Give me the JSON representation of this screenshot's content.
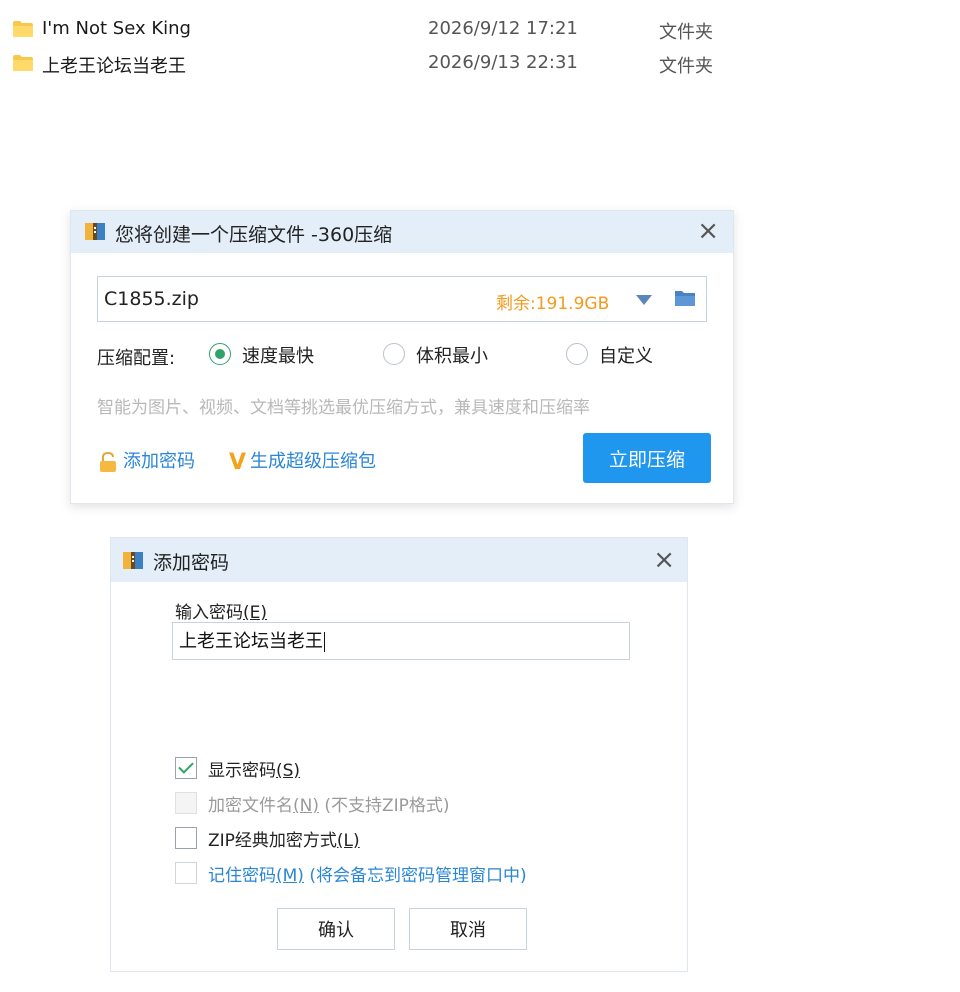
{
  "files": [
    {
      "name": "I'm Not Sex King",
      "date": "2026/9/12 17:21",
      "type": "文件夹"
    },
    {
      "name": "上老王论坛当老王",
      "date": "2026/9/13 22:31",
      "type": "文件夹"
    }
  ],
  "compress_dialog": {
    "title": "您将创建一个压缩文件 -360压缩",
    "close": "×",
    "filename": "C1855.zip",
    "free_space": "剩余:191.9GB",
    "config_label": "压缩配置:",
    "options": [
      {
        "label": "速度最快",
        "selected": true
      },
      {
        "label": "体积最小",
        "selected": false
      },
      {
        "label": "自定义",
        "selected": false
      }
    ],
    "hint": "智能为图片、视频、文档等挑选最优压缩方式，兼具速度和压缩率",
    "add_password": "添加密码",
    "super_package": "生成超级压缩包",
    "compress_now": "立即压缩"
  },
  "password_dialog": {
    "title": "添加密码",
    "close": "×",
    "input_label": "输入密码",
    "input_label_key": "(E)",
    "password_value": "上老王论坛当老王",
    "show_password": {
      "text": "显示密码",
      "key": "(S)",
      "checked": true
    },
    "encrypt_filename": {
      "text": "加密文件名",
      "key": "(N)",
      "suffix": " (不支持ZIP格式)",
      "checked": false,
      "disabled": true
    },
    "zip_classic": {
      "text": "ZIP经典加密方式",
      "key": "(L)",
      "checked": false
    },
    "remember": {
      "text": "记住密码",
      "key": "(M)",
      "suffix": " (将会备忘到密码管理窗口中)",
      "checked": false
    },
    "ok": "确认",
    "cancel": "取消"
  },
  "colors": {
    "accent": "#1f97ee",
    "link": "#2a86d6",
    "free_space": "#f29b1c",
    "check_green": "#2fa36a",
    "title_bar": "#e3eef9"
  },
  "icons": {
    "folder": "folder-icon",
    "app": "archive-app-icon",
    "lock": "lock-icon",
    "vip": "vip-v-icon"
  }
}
